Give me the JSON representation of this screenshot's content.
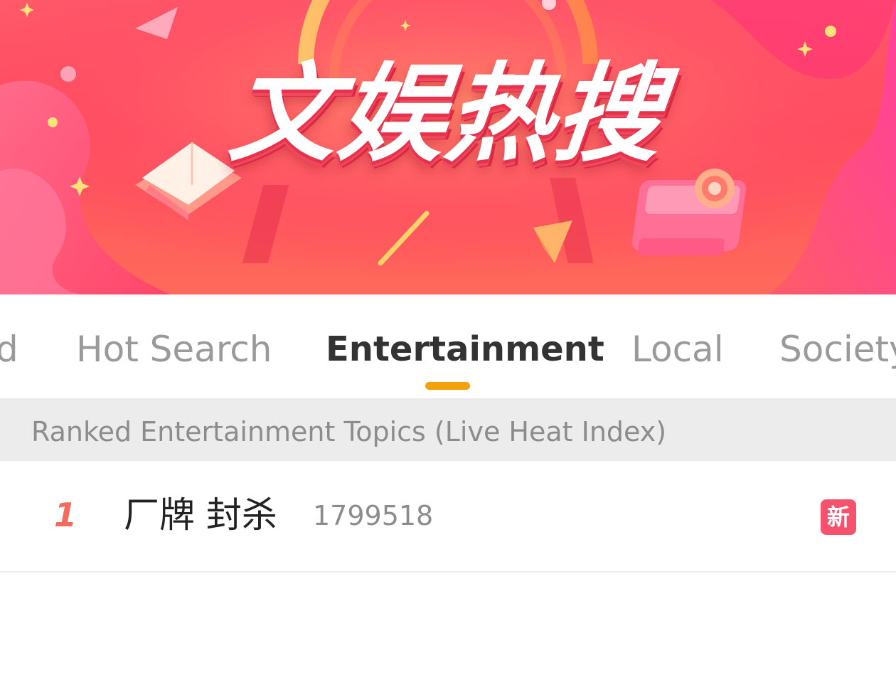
{
  "banner": {
    "title": "文娱热搜"
  },
  "tabs": [
    {
      "label": "d",
      "active": false
    },
    {
      "label": "Hot Search",
      "active": false
    },
    {
      "label": "Entertainment",
      "active": true
    },
    {
      "label": "Local",
      "active": false
    },
    {
      "label": "Society",
      "active": false
    }
  ],
  "section": {
    "header": "Ranked Entertainment Topics (Live Heat Index)"
  },
  "list": [
    {
      "rank": "1",
      "topic": "厂牌 封杀",
      "heat": "1799518",
      "badge": "新"
    }
  ],
  "colors": {
    "banner_primary": "#ff4f5f",
    "tab_indicator": "#f5a10b",
    "rank_number": "#f26b5b",
    "new_badge": "#f5536d",
    "section_header_bg": "#ececec"
  }
}
